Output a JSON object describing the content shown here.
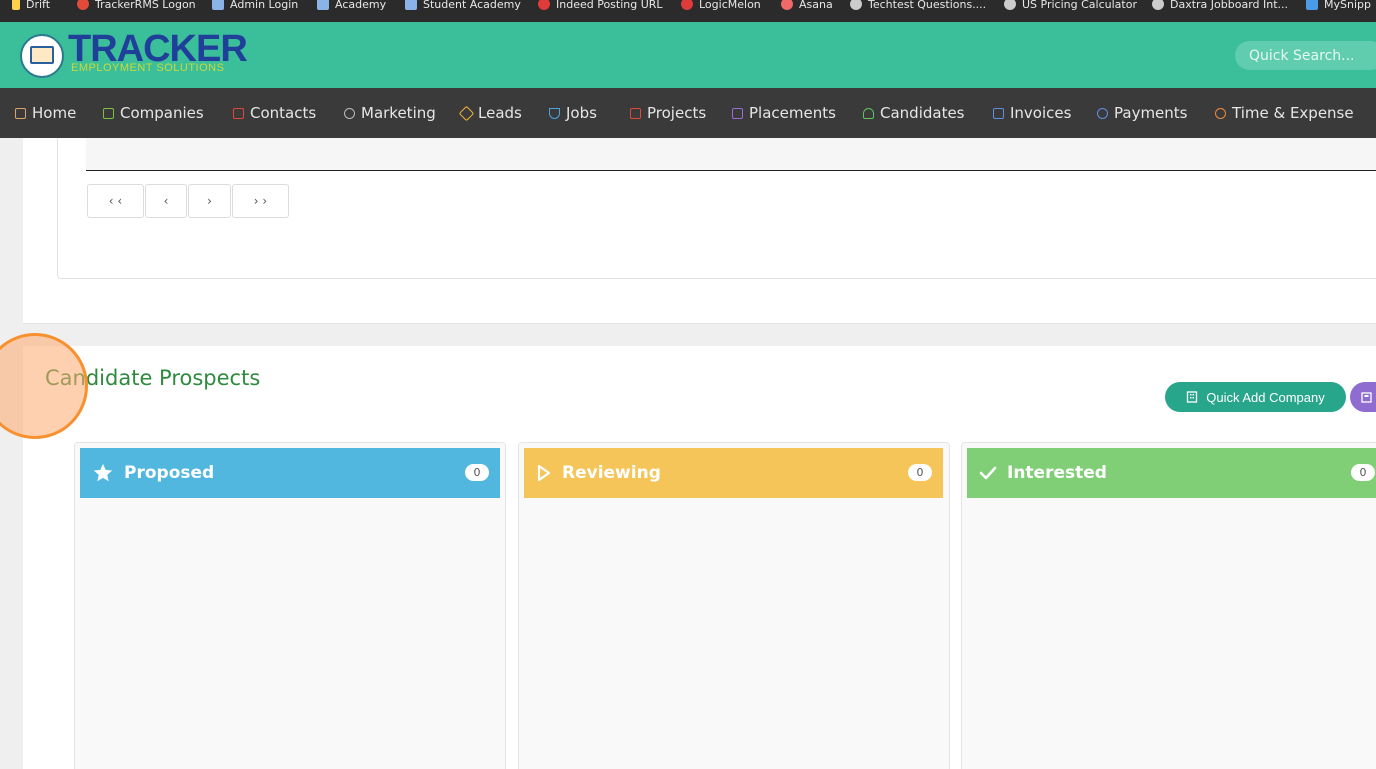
{
  "bookmarks": [
    {
      "label": "Drift",
      "icon": "drift-icon",
      "color": "#ffd24a"
    },
    {
      "label": "TrackerRMS Logon",
      "icon": "chrome-icon",
      "color": "#e24a3a"
    },
    {
      "label": "Admin Login",
      "icon": "doc-icon",
      "color": "#8ab4e8"
    },
    {
      "label": "Academy",
      "icon": "doc-icon",
      "color": "#8ab4e8"
    },
    {
      "label": "Student Academy",
      "icon": "doc-icon",
      "color": "#8ab4e8"
    },
    {
      "label": "Indeed Posting URL",
      "icon": "indeed-icon",
      "color": "#e03b3b"
    },
    {
      "label": "LogicMelon",
      "icon": "logicmelon-icon",
      "color": "#e03b3b"
    },
    {
      "label": "Asana",
      "icon": "asana-icon",
      "color": "#f06a6a"
    },
    {
      "label": "Techtest Questions....",
      "icon": "globe-icon",
      "color": "#cccccc"
    },
    {
      "label": "US Pricing Calculator",
      "icon": "globe-icon",
      "color": "#cccccc"
    },
    {
      "label": "Daxtra Jobboard Int...",
      "icon": "globe-icon",
      "color": "#cccccc"
    },
    {
      "label": "MySnipp",
      "icon": "snipp-icon",
      "color": "#4a9be8"
    }
  ],
  "header": {
    "brand": "TRACKER",
    "brand_sub": "EMPLOYMENT SOLUTIONS",
    "search_placeholder": "Quick Search..."
  },
  "nav": [
    {
      "label": "Home",
      "icon": "home-icon",
      "color": "#d9a36a"
    },
    {
      "label": "Companies",
      "icon": "building-icon",
      "color": "#7bc043"
    },
    {
      "label": "Contacts",
      "icon": "contact-card-icon",
      "color": "#e0483a"
    },
    {
      "label": "Marketing",
      "icon": "broadcast-icon",
      "color": "#bbbbbb"
    },
    {
      "label": "Leads",
      "icon": "target-icon",
      "color": "#f3b53b"
    },
    {
      "label": "Jobs",
      "icon": "trophy-icon",
      "color": "#4aa3e0"
    },
    {
      "label": "Projects",
      "icon": "checklist-icon",
      "color": "#e0483a"
    },
    {
      "label": "Placements",
      "icon": "briefcase-icon",
      "color": "#9b6bd6"
    },
    {
      "label": "Candidates",
      "icon": "user-icon",
      "color": "#5cc45c"
    },
    {
      "label": "Invoices",
      "icon": "invoice-icon",
      "color": "#5f8fe0"
    },
    {
      "label": "Payments",
      "icon": "payment-icon",
      "color": "#5f8fe0"
    },
    {
      "label": "Time & Expense",
      "icon": "clock-icon",
      "color": "#f08a3a"
    }
  ],
  "pager": [
    "‹ ‹",
    "‹",
    "›",
    "› ›"
  ],
  "prospects": {
    "title": "Candidate Prospects",
    "quick_add_label": "Quick Add Company",
    "columns": [
      {
        "label": "Proposed",
        "count": "0",
        "color": "#52b7df",
        "icon": "star-icon"
      },
      {
        "label": "Reviewing",
        "count": "0",
        "color": "#f5c55a",
        "icon": "play-icon"
      },
      {
        "label": "Interested",
        "count": "0",
        "color": "#80cf76",
        "icon": "check-icon"
      }
    ]
  }
}
